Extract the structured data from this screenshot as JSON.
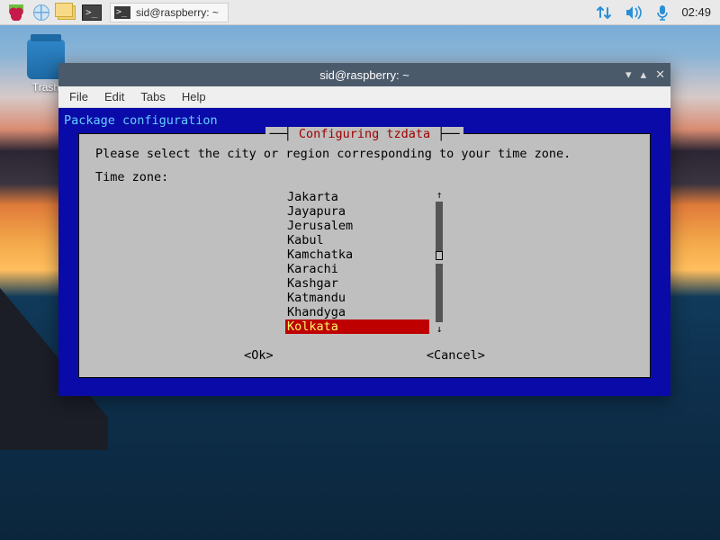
{
  "panel": {
    "taskbar_title": "sid@raspberry: ~",
    "clock": "02:49"
  },
  "desktop": {
    "trash_label": "Trash"
  },
  "window": {
    "title": "sid@raspberry: ~",
    "menus": [
      "File",
      "Edit",
      "Tabs",
      "Help"
    ]
  },
  "terminal": {
    "pkg_line": "Package configuration",
    "dialog_title": "Configuring tzdata",
    "prompt": "Please select the city or region corresponding to your time zone.",
    "field_label": "Time zone:",
    "items": [
      "Jakarta",
      "Jayapura",
      "Jerusalem",
      "Kabul",
      "Kamchatka",
      "Karachi",
      "Kashgar",
      "Katmandu",
      "Khandyga",
      "Kolkata"
    ],
    "selected_index": 9,
    "ok_label": "<Ok>",
    "cancel_label": "<Cancel>"
  }
}
